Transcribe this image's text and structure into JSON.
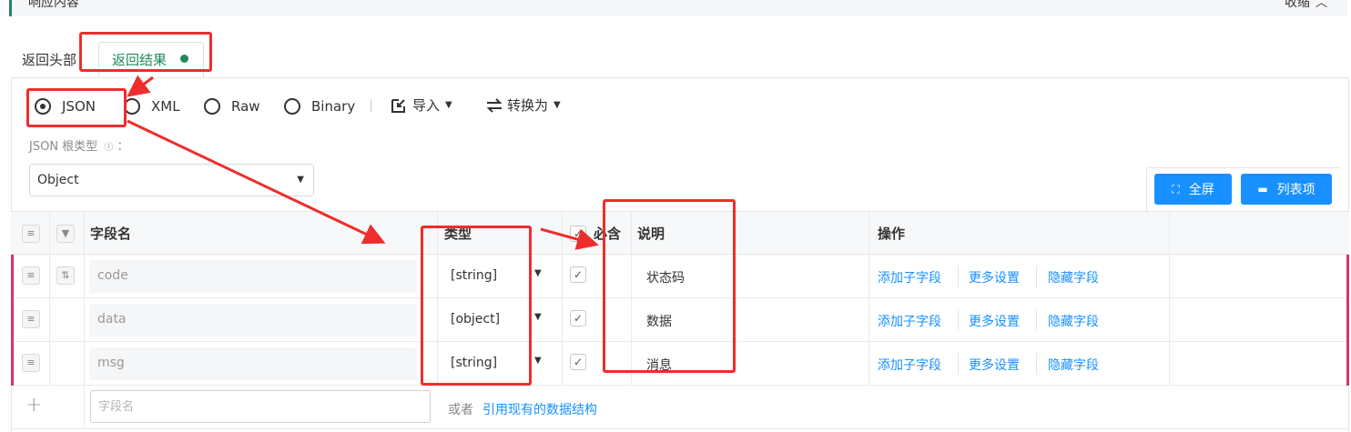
{
  "section": {
    "title": "响应内容",
    "collapse_label": "收缩"
  },
  "tabs": [
    {
      "label": "返回头部"
    },
    {
      "label": "返回结果"
    }
  ],
  "formats": [
    "JSON",
    "XML",
    "Raw",
    "Binary"
  ],
  "selected_format": "JSON",
  "toolbar": {
    "import_label": "导入",
    "convert_label": "转换为"
  },
  "root_type": {
    "label": "JSON 根类型",
    "info_icon": "info-icon",
    "colon": "：",
    "value": "Object"
  },
  "view_buttons": {
    "fullscreen_label": "全屏",
    "columns_label": "列表项"
  },
  "table": {
    "headers": {
      "name": "字段名",
      "type": "类型",
      "required": "必含",
      "description": "说明",
      "actions": "操作"
    },
    "rows": [
      {
        "name": "code",
        "type": "[string]",
        "required": true,
        "description": "状态码",
        "actions": [
          "添加子字段",
          "更多设置",
          "隐藏字段"
        ]
      },
      {
        "name": "data",
        "type": "[object]",
        "required": true,
        "description": "数据",
        "actions": [
          "添加子字段",
          "更多设置",
          "隐藏字段"
        ]
      },
      {
        "name": "msg",
        "type": "[string]",
        "required": true,
        "description": "消息",
        "actions": [
          "添加子字段",
          "更多设置",
          "隐藏字段"
        ]
      }
    ]
  },
  "add_row": {
    "placeholder": "字段名",
    "or_text": "或者",
    "reference_link": "引用现有的数据结构"
  },
  "colors": {
    "accent_green": "#1f8a5c",
    "link_blue": "#1890ff",
    "annotation_red": "#ee2d2d",
    "row_marker": "#d9336c"
  }
}
